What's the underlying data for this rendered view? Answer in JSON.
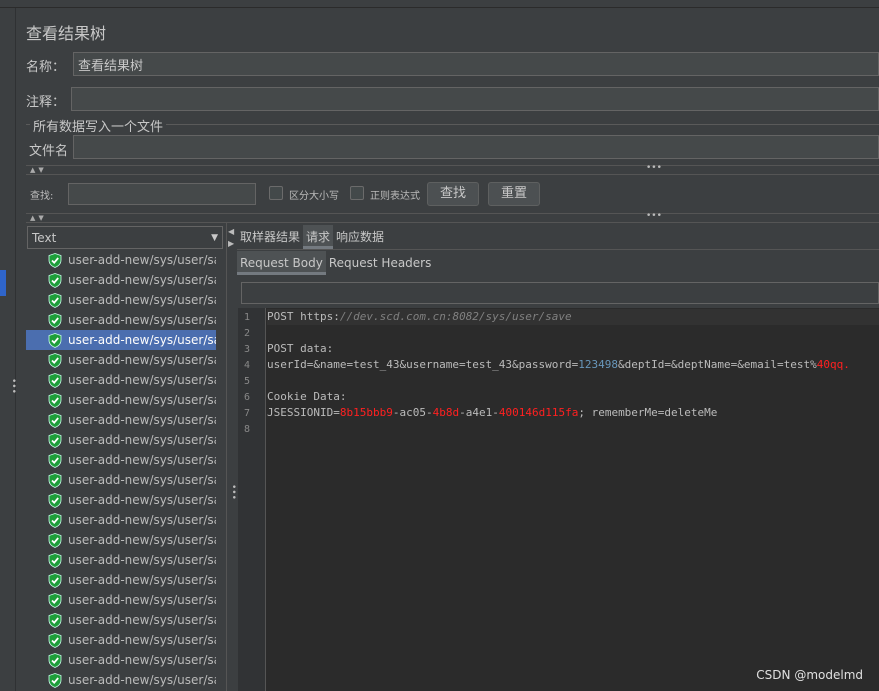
{
  "panel": {
    "title": "查看结果树",
    "name_label": "名称：",
    "name_value": "查看结果树",
    "comment_label": "注释：",
    "comment_value": "",
    "file_group_label": "所有数据写入一个文件",
    "filename_label": "文件名",
    "filename_value": ""
  },
  "search": {
    "label": "查找:",
    "value": "",
    "case_label": "区分大小写",
    "case_checked": false,
    "regex_label": "正则表达式",
    "regex_checked": false,
    "find_button": "查找",
    "reset_button": "重置"
  },
  "renderer": {
    "selected": "Text"
  },
  "results": {
    "items": [
      "user-add-new/sys/user/save",
      "user-add-new/sys/user/save",
      "user-add-new/sys/user/save",
      "user-add-new/sys/user/save",
      "user-add-new/sys/user/save",
      "user-add-new/sys/user/save",
      "user-add-new/sys/user/save",
      "user-add-new/sys/user/save",
      "user-add-new/sys/user/save",
      "user-add-new/sys/user/save",
      "user-add-new/sys/user/save",
      "user-add-new/sys/user/save",
      "user-add-new/sys/user/save",
      "user-add-new/sys/user/save",
      "user-add-new/sys/user/save",
      "user-add-new/sys/user/save",
      "user-add-new/sys/user/save",
      "user-add-new/sys/user/save",
      "user-add-new/sys/user/save",
      "user-add-new/sys/user/save",
      "user-add-new/sys/user/save",
      "user-add-new/sys/user/save"
    ],
    "selected_index": 4,
    "status_icon": "success-shield-icon"
  },
  "tabs": [
    {
      "label": "取样器结果",
      "active": false
    },
    {
      "label": "请求",
      "active": true
    },
    {
      "label": "响应数据",
      "active": false
    }
  ],
  "subtabs": [
    {
      "label": "Request Body",
      "active": true
    },
    {
      "label": "Request Headers",
      "active": false
    }
  ],
  "editor": {
    "line_numbers": [
      "1",
      "2",
      "3",
      "4",
      "5",
      "6",
      "7",
      "8"
    ],
    "l1a": "POST https:",
    "l1b": "//dev.scd.com.cn:8082/sys/user/save",
    "l3": "POST data:",
    "l4a": "userId=&name=test_43&username=test_43&password=",
    "l4b": "123498",
    "l4c": "&deptId=&deptName=&email=test%",
    "l4d": "40qq.",
    "l6": "Cookie Data:",
    "l7a": "JSESSIONID=",
    "l7b": "8b15bbb9",
    "l7c": "-ac05-",
    "l7d": "4b8d",
    "l7e": "-a4e1-",
    "l7f": "400146d115fa",
    "l7g": "; rememberMe=deleteMe"
  },
  "watermark": "CSDN @modelmd",
  "colors": {
    "background": "#3c3f41",
    "selection": "#4b6eaf",
    "success": "#2ecc40",
    "highlight_red": "#ff2020",
    "number_blue": "#6897bb"
  }
}
